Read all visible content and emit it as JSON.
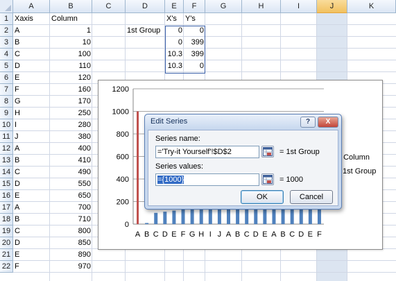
{
  "sheet": {
    "columns": [
      "A",
      "B",
      "C",
      "D",
      "E",
      "F",
      "G",
      "H",
      "I",
      "J",
      "K"
    ],
    "selected_column": "J",
    "rows": [
      "1",
      "2",
      "3",
      "4",
      "5",
      "6",
      "7",
      "8",
      "9",
      "10",
      "11",
      "12",
      "13",
      "14",
      "15",
      "16",
      "17",
      "18",
      "19",
      "20",
      "21",
      "22"
    ],
    "col_a": [
      "Xaxis",
      "A",
      "B",
      "C",
      "D",
      "E",
      "F",
      "G",
      "H",
      "I",
      "J",
      "A",
      "B",
      "C",
      "D",
      "E",
      "A",
      "B",
      "C",
      "D",
      "E",
      "F"
    ],
    "col_b": [
      "Column",
      "1",
      "10",
      "100",
      "110",
      "120",
      "160",
      "170",
      "250",
      "280",
      "380",
      "400",
      "410",
      "490",
      "550",
      "650",
      "700",
      "710",
      "800",
      "850",
      "890",
      "970"
    ],
    "d2": "1st Group",
    "e_header": "X's",
    "f_header": "Y's",
    "e_values": [
      "0",
      "0",
      "10.3",
      "10.3"
    ],
    "f_values": [
      "0",
      "399",
      "399",
      "0"
    ]
  },
  "chart": {
    "y_ticks": [
      "0",
      "200",
      "400",
      "600",
      "800",
      "1000",
      "1200"
    ],
    "legend": [
      "Column",
      "1st Group"
    ]
  },
  "chart_data": {
    "type": "bar",
    "categories": [
      "A",
      "B",
      "C",
      "D",
      "E",
      "F",
      "G",
      "H",
      "I",
      "J",
      "A",
      "B",
      "C",
      "D",
      "E",
      "A",
      "B",
      "C",
      "D",
      "E",
      "F"
    ],
    "series": [
      {
        "name": "Column",
        "values": [
          1,
          10,
          100,
          110,
          120,
          160,
          170,
          250,
          280,
          380,
          400,
          410,
          490,
          550,
          650,
          700,
          710,
          800,
          850,
          890,
          970
        ]
      },
      {
        "name": "1st Group",
        "values": [
          1000
        ]
      }
    ],
    "ylim": [
      0,
      1200
    ],
    "grid": true,
    "legend_position": "right",
    "colors": {
      "column": "#4f81bd",
      "group": "#c0504d"
    }
  },
  "dialog": {
    "title": "Edit Series",
    "help_label": "?",
    "close_label": "X",
    "series_name_label": "Series name:",
    "series_name_value": "='Try-it Yourself'!$D$2",
    "series_name_result": "= 1st Group",
    "series_values_label": "Series values:",
    "series_values_value": "={1000}",
    "series_values_result": "= 1000",
    "ok_label": "OK",
    "cancel_label": "Cancel"
  }
}
